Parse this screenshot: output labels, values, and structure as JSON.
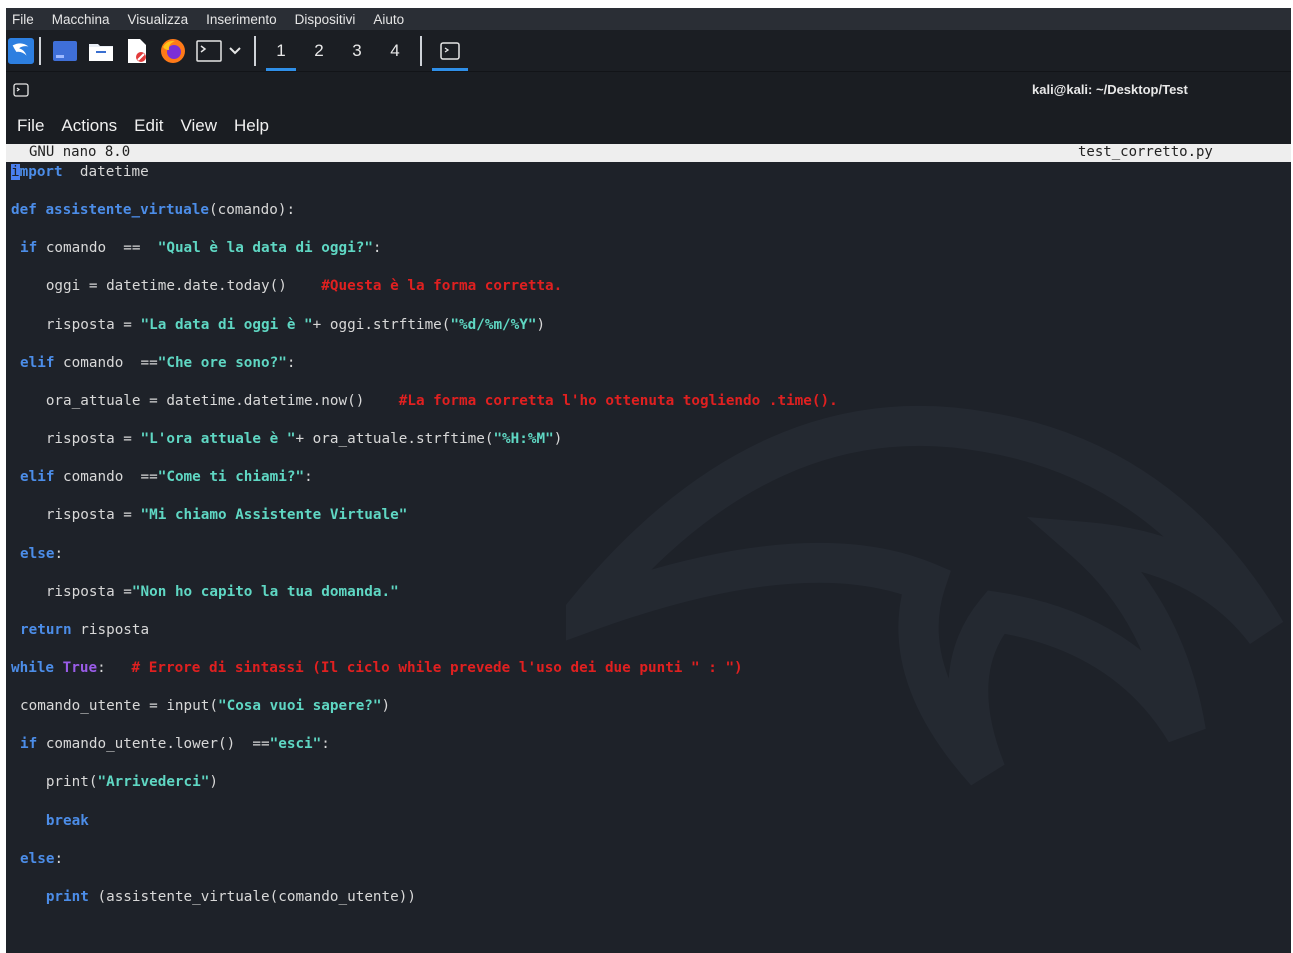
{
  "vm_menu": [
    "File",
    "Macchina",
    "Visualizza",
    "Inserimento",
    "Dispositivi",
    "Aiuto"
  ],
  "panel": {
    "icons": [
      "kali-dragon-icon",
      "desktop-icon",
      "file-manager-icon",
      "text-editor-icon",
      "firefox-icon",
      "terminal-icon",
      "chevron-down-icon"
    ],
    "workspaces": [
      "1",
      "2",
      "3",
      "4"
    ],
    "active_workspace": "1"
  },
  "terminal": {
    "title": "kali@kali: ~/Desktop/Test",
    "menu": [
      "File",
      "Actions",
      "Edit",
      "View",
      "Help"
    ]
  },
  "nano": {
    "version": "GNU nano 8.0",
    "filename": "test_corretto.py"
  },
  "code_lines": [
    [
      [
        "cursor",
        "i"
      ],
      [
        "kw",
        "mport"
      ],
      [
        "",
        "  datetime"
      ]
    ],
    [
      [
        "kw",
        "def "
      ],
      [
        "kw",
        "assistente_virtuale"
      ],
      [
        "",
        "(comando):"
      ]
    ],
    [
      [
        "",
        ""
      ],
      [
        "kw",
        "if"
      ],
      [
        "",
        " comando  ==  "
      ],
      [
        "str",
        "\"Qual è la data di oggi?\""
      ],
      [
        "",
        ":"
      ]
    ],
    [
      [
        "",
        "   oggi = datetime.date.today()    "
      ],
      [
        "cmt",
        "#Questa è la forma corretta."
      ]
    ],
    [
      [
        "",
        "   risposta = "
      ],
      [
        "str",
        "\"La data di oggi è \""
      ],
      [
        "",
        "+ oggi.strftime("
      ],
      [
        "str",
        "\"%d/%m/%Y\""
      ],
      [
        "",
        ")"
      ]
    ],
    [
      [
        "",
        ""
      ],
      [
        "kw",
        "elif"
      ],
      [
        "",
        " comando  =="
      ],
      [
        "str",
        "\"Che ore sono?\""
      ],
      [
        "",
        ":"
      ]
    ],
    [
      [
        "",
        "   ora_attuale = datetime.datetime.now()    "
      ],
      [
        "cmt",
        "#La forma corretta l'ho ottenuta togliendo .time()."
      ]
    ],
    [
      [
        "",
        "   risposta = "
      ],
      [
        "str",
        "\"L'ora attuale è \""
      ],
      [
        "",
        "+ ora_attuale.strftime("
      ],
      [
        "str",
        "\"%H:%M\""
      ],
      [
        "",
        ")"
      ]
    ],
    [
      [
        "",
        ""
      ],
      [
        "kw",
        "elif"
      ],
      [
        "",
        " comando  =="
      ],
      [
        "str",
        "\"Come ti chiami?\""
      ],
      [
        "",
        ":"
      ]
    ],
    [
      [
        "",
        "   risposta = "
      ],
      [
        "str",
        "\"Mi chiamo Assistente Virtuale\""
      ]
    ],
    [
      [
        "",
        ""
      ],
      [
        "kw",
        "else"
      ],
      [
        "",
        ":"
      ]
    ],
    [
      [
        "",
        "   risposta ="
      ],
      [
        "str",
        "\"Non ho capito la tua domanda.\""
      ]
    ],
    [
      [
        "",
        ""
      ],
      [
        "kw",
        "return"
      ],
      [
        "",
        " risposta"
      ]
    ],
    [
      [
        "kw",
        "while"
      ],
      [
        "",
        " "
      ],
      [
        "kw2",
        "True"
      ],
      [
        "",
        ":   "
      ],
      [
        "cmt",
        "# Errore di sintassi (Il ciclo while prevede l'uso dei due punti \" : \")"
      ]
    ],
    [
      [
        "",
        ""
      ],
      [
        "",
        "comando_utente = input("
      ],
      [
        "str",
        "\"Cosa vuoi sapere?\""
      ],
      [
        "",
        ")"
      ]
    ],
    [
      [
        "",
        ""
      ],
      [
        "kw",
        "if"
      ],
      [
        "",
        " comando_utente.lower()  =="
      ],
      [
        "str",
        "\"esci\""
      ],
      [
        "",
        ":"
      ]
    ],
    [
      [
        "",
        "   print("
      ],
      [
        "str",
        "\"Arrivederci\""
      ],
      [
        "",
        ")"
      ]
    ],
    [
      [
        "",
        "   "
      ],
      [
        "kw",
        "break"
      ]
    ],
    [
      [
        "",
        ""
      ],
      [
        "kw",
        "else"
      ],
      [
        "",
        ":"
      ]
    ],
    [
      [
        "",
        "   "
      ],
      [
        "kw",
        "print"
      ],
      [
        "",
        " (assistente_virtuale(comando_utente))"
      ]
    ]
  ]
}
